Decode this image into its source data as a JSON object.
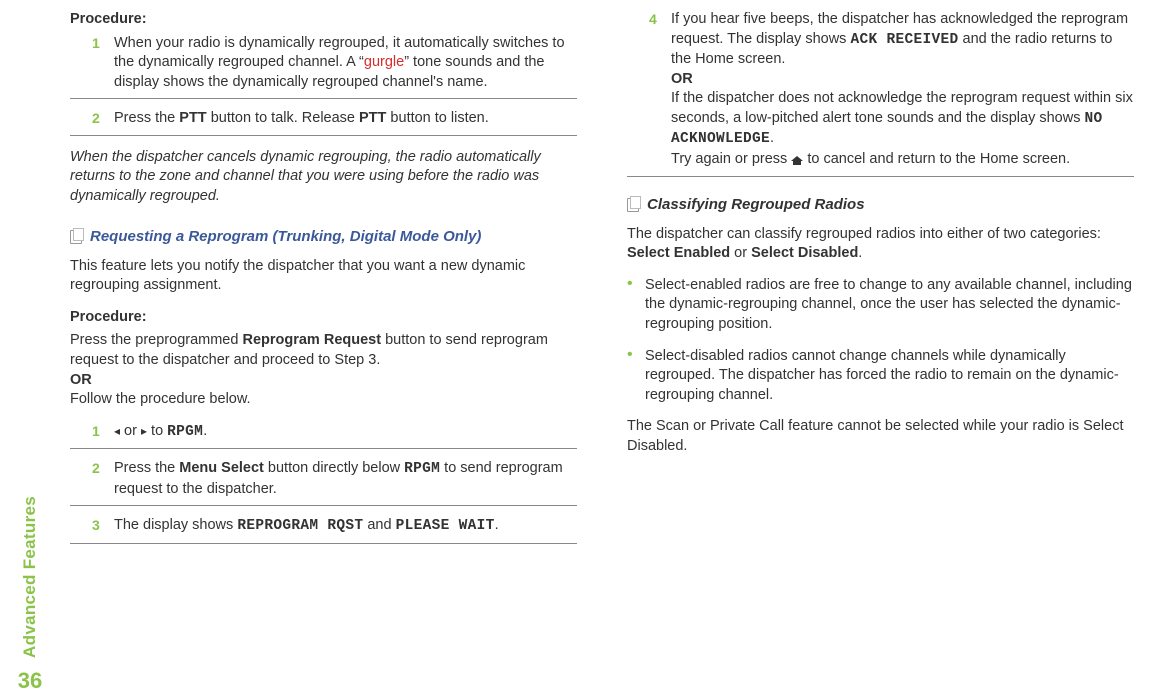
{
  "sidebar": {
    "label": "Advanced Features",
    "pageNum": "36"
  },
  "left": {
    "procLabel": "Procedure:",
    "step1Num": "1",
    "step1a": "When your radio is dynamically regrouped, it automatically switches to the dynamically regrouped channel. A “",
    "step1g": "gurgle",
    "step1b": "” tone sounds and the display shows the dynamically regrouped channel's name.",
    "step2Num": "2",
    "step2a": "Press the ",
    "step2ptt1": "PTT",
    "step2b": " button to talk. Release ",
    "step2ptt2": "PTT",
    "step2c": " button to listen.",
    "cancelNote": "When the dispatcher cancels dynamic regrouping, the radio automatically returns to the zone and channel that you were using before the radio was dynamically regrouped.",
    "reqTitle": "Requesting a Reprogram (Trunking, Digital Mode Only)",
    "reqDesc": "This feature lets you notify the dispatcher that you want a new dynamic regrouping assignment.",
    "proc2Label": "Procedure:",
    "proc2a": "Press the preprogrammed ",
    "proc2b": "Reprogram Request",
    "proc2c": " button to send reprogram request to the dispatcher and proceed to Step 3.",
    "or": "OR",
    "follow": "Follow the procedure below.",
    "s1Num": "1",
    "s1arrowL": "◂",
    "s1or": " or ",
    "s1arrowR": "▸",
    "s1to": " to ",
    "s1rpgm": "RPGM",
    "s1dot": ".",
    "s2Num": "2",
    "s2a": "Press the ",
    "s2b": "Menu Select",
    "s2c": " button directly below ",
    "s2rpgm": "RPGM",
    "s2d": " to send reprogram request to the dispatcher.",
    "s3Num": "3",
    "s3a": "The display shows ",
    "s3r1": "REPROGRAM RQST",
    "s3and": " and ",
    "s3r2": "PLEASE WAIT",
    "s3dot": "."
  },
  "right": {
    "s4Num": "4",
    "s4a": "If you hear five beeps, the dispatcher has acknowledged the reprogram request. The display shows ",
    "s4ack": "ACK RECEIVED",
    "s4b": " and the radio returns to the Home screen.",
    "s4or": "OR",
    "s4c": "If the dispatcher does not acknowledge the reprogram request within six seconds, a low-pitched alert tone sounds and the display shows ",
    "s4no": "NO ACKNOWLEDGE",
    "s4dot": ".",
    "s4try": "Try again or press ",
    "s4home": " to cancel and return to the Home screen.",
    "classTitle": "Classifying Regrouped Radios",
    "classDesc1": "The dispatcher can classify regrouped radios into either of two categories: ",
    "classSE": "Select Enabled",
    "classOr": " or ",
    "classSD": "Select Disabled",
    "classDot": ".",
    "b1": "Select-enabled radios are free to change to any available channel, including the dynamic-regrouping channel, once the user has selected the dynamic-regrouping position.",
    "b2": "Select-disabled radios cannot change channels while dynamically regrouped. The dispatcher has forced the radio to remain on the dynamic-regrouping channel.",
    "scanNote": "The Scan or Private Call feature cannot be selected while your radio is Select Disabled."
  }
}
